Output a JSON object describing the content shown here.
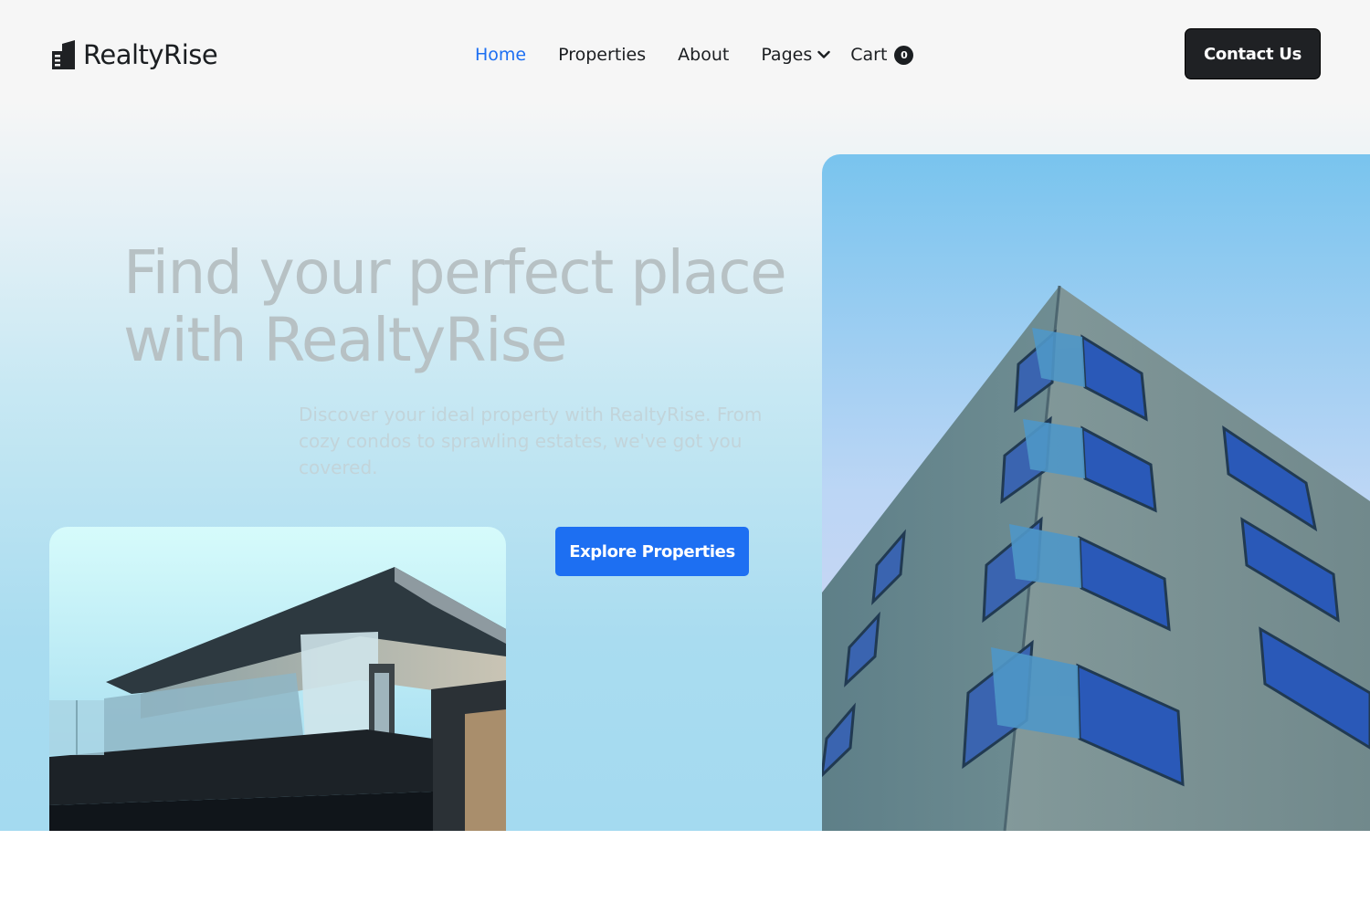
{
  "brand": {
    "name": "RealtyRise",
    "icon": "building-logo-icon"
  },
  "nav": {
    "items": [
      {
        "label": "Home",
        "active": true
      },
      {
        "label": "Properties",
        "active": false
      },
      {
        "label": "About",
        "active": false
      }
    ],
    "pages_label": "Pages",
    "cart_label": "Cart",
    "cart_count": "0"
  },
  "header": {
    "contact_label": "Contact Us"
  },
  "hero": {
    "headline_line1": "Find your perfect place",
    "headline_line2": "with RealtyRise",
    "subtext": "Discover your ideal property with RealtyRise. From cozy condos to sprawling estates, we've got you covered.",
    "cta_label": "Explore Properties"
  },
  "colors": {
    "accent": "#1d6ff2",
    "dark": "#1f2124",
    "hero_bg": "#a9dcf0"
  }
}
